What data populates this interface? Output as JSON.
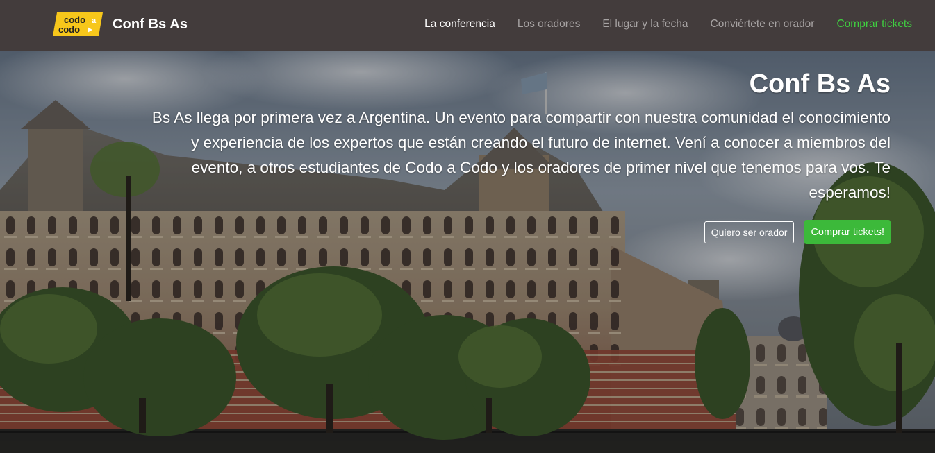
{
  "header": {
    "logo_line1": "codo",
    "logo_line2": "codo",
    "logo_letter": "a",
    "brand": "Conf Bs As",
    "nav": [
      {
        "label": "La conferencia"
      },
      {
        "label": "Los oradores"
      },
      {
        "label": "El lugar y la fecha"
      },
      {
        "label": "Conviértete en orador"
      },
      {
        "label": "Comprar tickets"
      }
    ]
  },
  "hero": {
    "title": "Conf Bs As",
    "text": "Bs As llega por primera vez a Argentina. Un evento para compartir con nuestra comunidad el conocimiento y experiencia de los expertos que están creando el futuro de internet. Vení a conocer a miembros del evento, a otros estudiantes de Codo a Codo y los oradores de primer nivel que tenemos para vos. Te esperamos!",
    "button_speaker": "Quiero ser orador",
    "button_tickets": "Comprar tickets!"
  },
  "colors": {
    "navbar": "#433c3c",
    "accent_green": "#3cb93a",
    "logo_yellow": "#f7c71b"
  },
  "icons": [
    "codo-a-codo-logo"
  ]
}
